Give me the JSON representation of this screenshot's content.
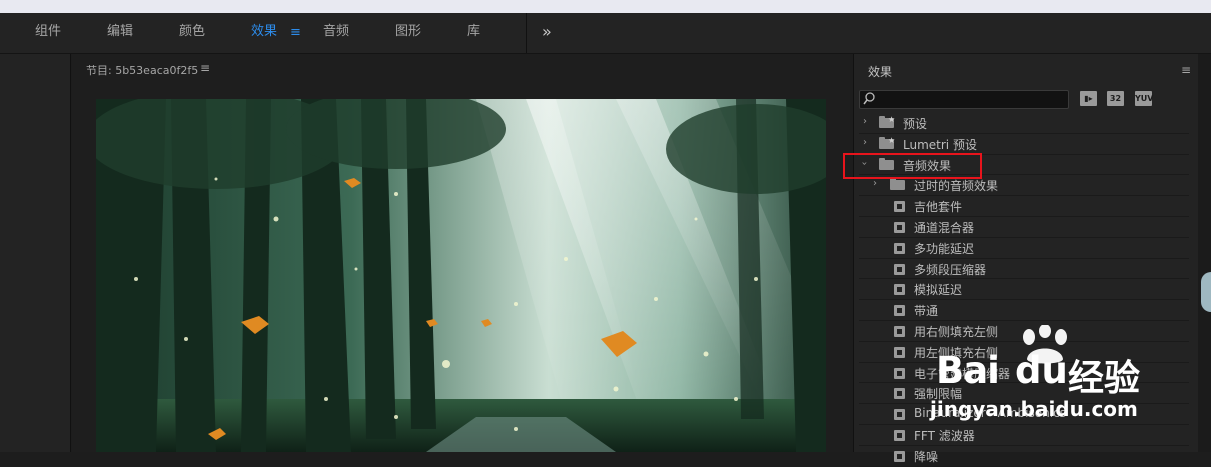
{
  "workspace_tabs": [
    {
      "label": "组件",
      "active": false
    },
    {
      "label": "编辑",
      "active": false
    },
    {
      "label": "颜色",
      "active": false
    },
    {
      "label": "效果",
      "active": true
    },
    {
      "label": "音频",
      "active": false
    },
    {
      "label": "图形",
      "active": false
    },
    {
      "label": "库",
      "active": false
    }
  ],
  "workspace_menu_icon": "≡",
  "overflow_icon": "»",
  "program_panel": {
    "title": "节目: 5b53eaca0f2f5",
    "menu_icon": "≡"
  },
  "effects_panel": {
    "title": "效果",
    "menu_icon": "≡",
    "search": {
      "value": "",
      "placeholder": ""
    },
    "badges": [
      "32",
      "YUV"
    ],
    "items": [
      {
        "label": "预设",
        "kind": "folder-star",
        "expanded": false
      },
      {
        "label": "Lumetri 预设",
        "kind": "folder-star",
        "expanded": false
      },
      {
        "label": "音频效果",
        "kind": "folder",
        "expanded": true
      },
      {
        "label": "过时的音频效果",
        "kind": "folder",
        "expanded": false
      },
      {
        "label": "吉他套件",
        "kind": "effect"
      },
      {
        "label": "通道混合器",
        "kind": "effect"
      },
      {
        "label": "多功能延迟",
        "kind": "effect"
      },
      {
        "label": "多频段压缩器",
        "kind": "effect"
      },
      {
        "label": "模拟延迟",
        "kind": "effect"
      },
      {
        "label": "带通",
        "kind": "effect"
      },
      {
        "label": "用右侧填充左侧",
        "kind": "effect"
      },
      {
        "label": "用左侧填充右侧",
        "kind": "effect"
      },
      {
        "label": "电子管建模压缩器",
        "kind": "effect"
      },
      {
        "label": "强制限幅",
        "kind": "effect"
      },
      {
        "label": "Binauralizer - Ambisonics",
        "kind": "effect"
      },
      {
        "label": "FFT 滤波器",
        "kind": "effect"
      },
      {
        "label": "降噪",
        "kind": "effect"
      }
    ]
  },
  "watermark": {
    "brand_latin": "Bai",
    "brand_latin2": "du",
    "brand_cn": "经验",
    "url": "jingyan.baidu.com"
  },
  "colors": {
    "accent": "#2d8ceb",
    "highlight": "#e8141c",
    "panel": "#232323"
  }
}
